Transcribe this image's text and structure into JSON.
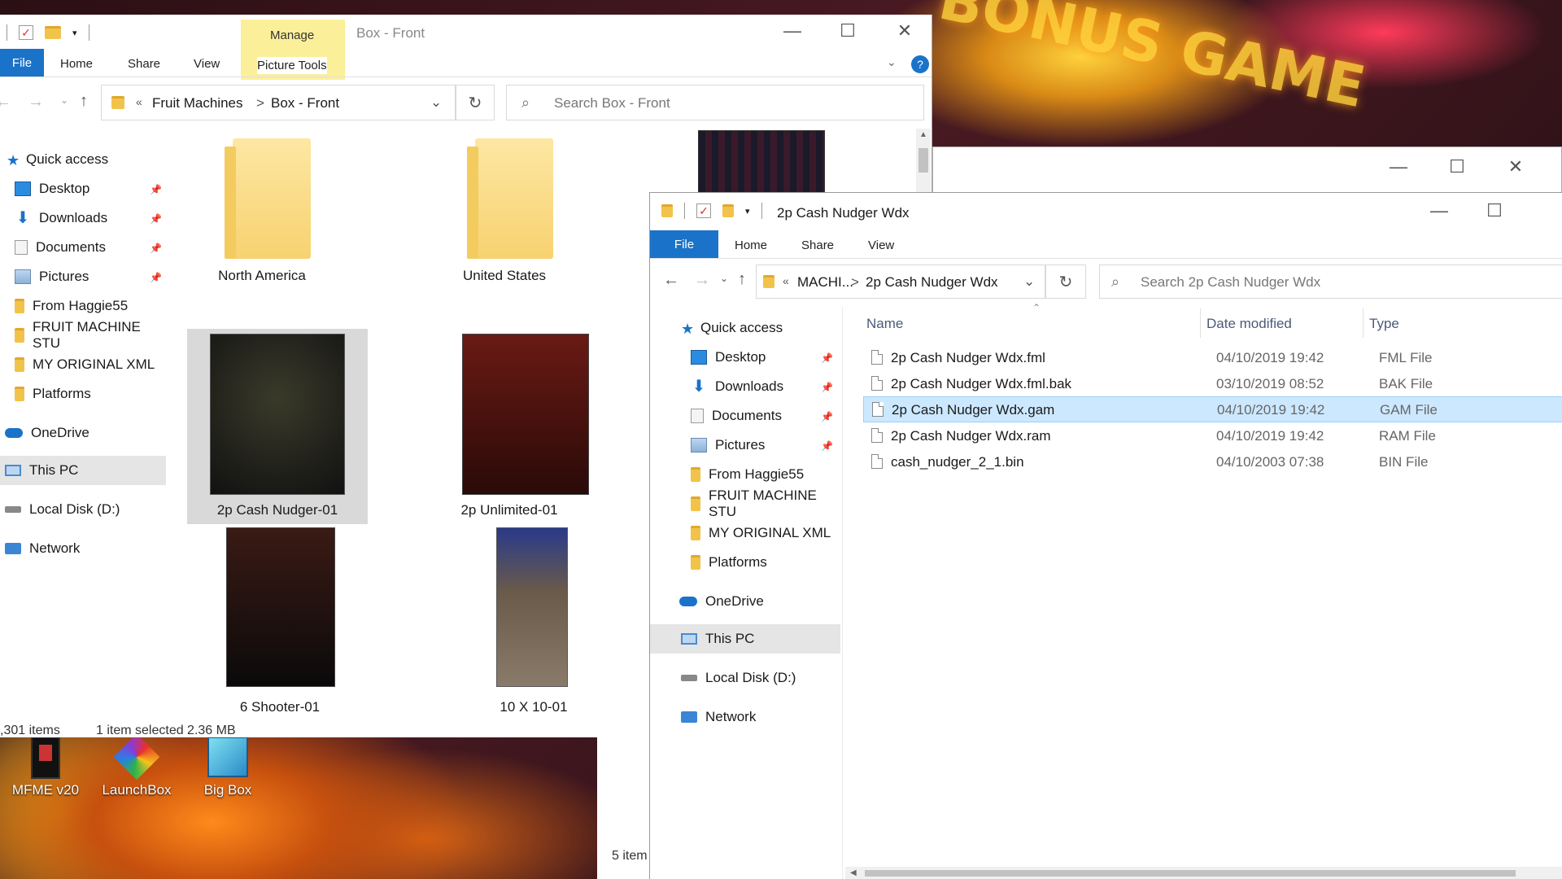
{
  "desktop": {
    "icons": [
      {
        "label": "MFME v20"
      },
      {
        "label": "LaunchBox"
      },
      {
        "label": "Big Box"
      }
    ],
    "neon_text": "BONUS GAME"
  },
  "win1": {
    "title": "Box - Front",
    "manage_label": "Manage",
    "ribbon": {
      "file": "File",
      "home": "Home",
      "share": "Share",
      "view": "View",
      "picture_tools": "Picture Tools"
    },
    "address": {
      "prefix": "«",
      "crumb1": "Fruit Machines",
      "sep": ">",
      "crumb2": "Box - Front"
    },
    "search_placeholder": "Search Box - Front",
    "nav": {
      "quick_access": "Quick access",
      "desktop": "Desktop",
      "downloads": "Downloads",
      "documents": "Documents",
      "pictures": "Pictures",
      "from_haggie": "From Haggie55",
      "fruit_machine": "FRUIT MACHINE STU",
      "my_original": "MY ORIGINAL XML",
      "platforms": "Platforms",
      "onedrive": "OneDrive",
      "this_pc": "This PC",
      "local_disk": "Local Disk (D:)",
      "network": "Network"
    },
    "tiles": {
      "north_america": "North America",
      "united_states": "United States",
      "cash_nudger": "2p Cash Nudger-01",
      "unlimited": "2p Unlimited-01",
      "shooter": "6 Shooter-01",
      "ten_x_ten": "10 X 10-01"
    },
    "status": {
      "count": ",301 items",
      "selected": "1 item selected  2.36 MB"
    }
  },
  "win3": {
    "title": "2p Cash Nudger Wdx",
    "ribbon": {
      "file": "File",
      "home": "Home",
      "share": "Share",
      "view": "View"
    },
    "address": {
      "prefix": "«",
      "crumb1": "MACHI...",
      "sep": ">",
      "crumb2": "2p Cash Nudger Wdx"
    },
    "search_placeholder": "Search 2p Cash Nudger Wdx",
    "nav": {
      "quick_access": "Quick access",
      "desktop": "Desktop",
      "downloads": "Downloads",
      "documents": "Documents",
      "pictures": "Pictures",
      "from_haggie": "From Haggie55",
      "fruit_machine": "FRUIT MACHINE STU",
      "my_original": "MY ORIGINAL XML",
      "platforms": "Platforms",
      "onedrive": "OneDrive",
      "this_pc": "This PC",
      "local_disk": "Local Disk (D:)",
      "network": "Network"
    },
    "columns": {
      "name": "Name",
      "date": "Date modified",
      "type": "Type"
    },
    "files": [
      {
        "name": "2p Cash Nudger Wdx.fml",
        "date": "04/10/2019 19:42",
        "type": "FML File"
      },
      {
        "name": "2p Cash Nudger Wdx.fml.bak",
        "date": "03/10/2019 08:52",
        "type": "BAK File"
      },
      {
        "name": "2p Cash Nudger Wdx.gam",
        "date": "04/10/2019 19:42",
        "type": "GAM File"
      },
      {
        "name": "2p Cash Nudger Wdx.ram",
        "date": "04/10/2019 19:42",
        "type": "RAM File"
      },
      {
        "name": "cash_nudger_2_1.bin",
        "date": "04/10/2003 07:38",
        "type": "BIN File"
      }
    ],
    "status": "5 item"
  },
  "colors": {
    "accent": "#1a73c8",
    "selection": "#cce8ff",
    "manage_tab": "#fbef9a"
  }
}
